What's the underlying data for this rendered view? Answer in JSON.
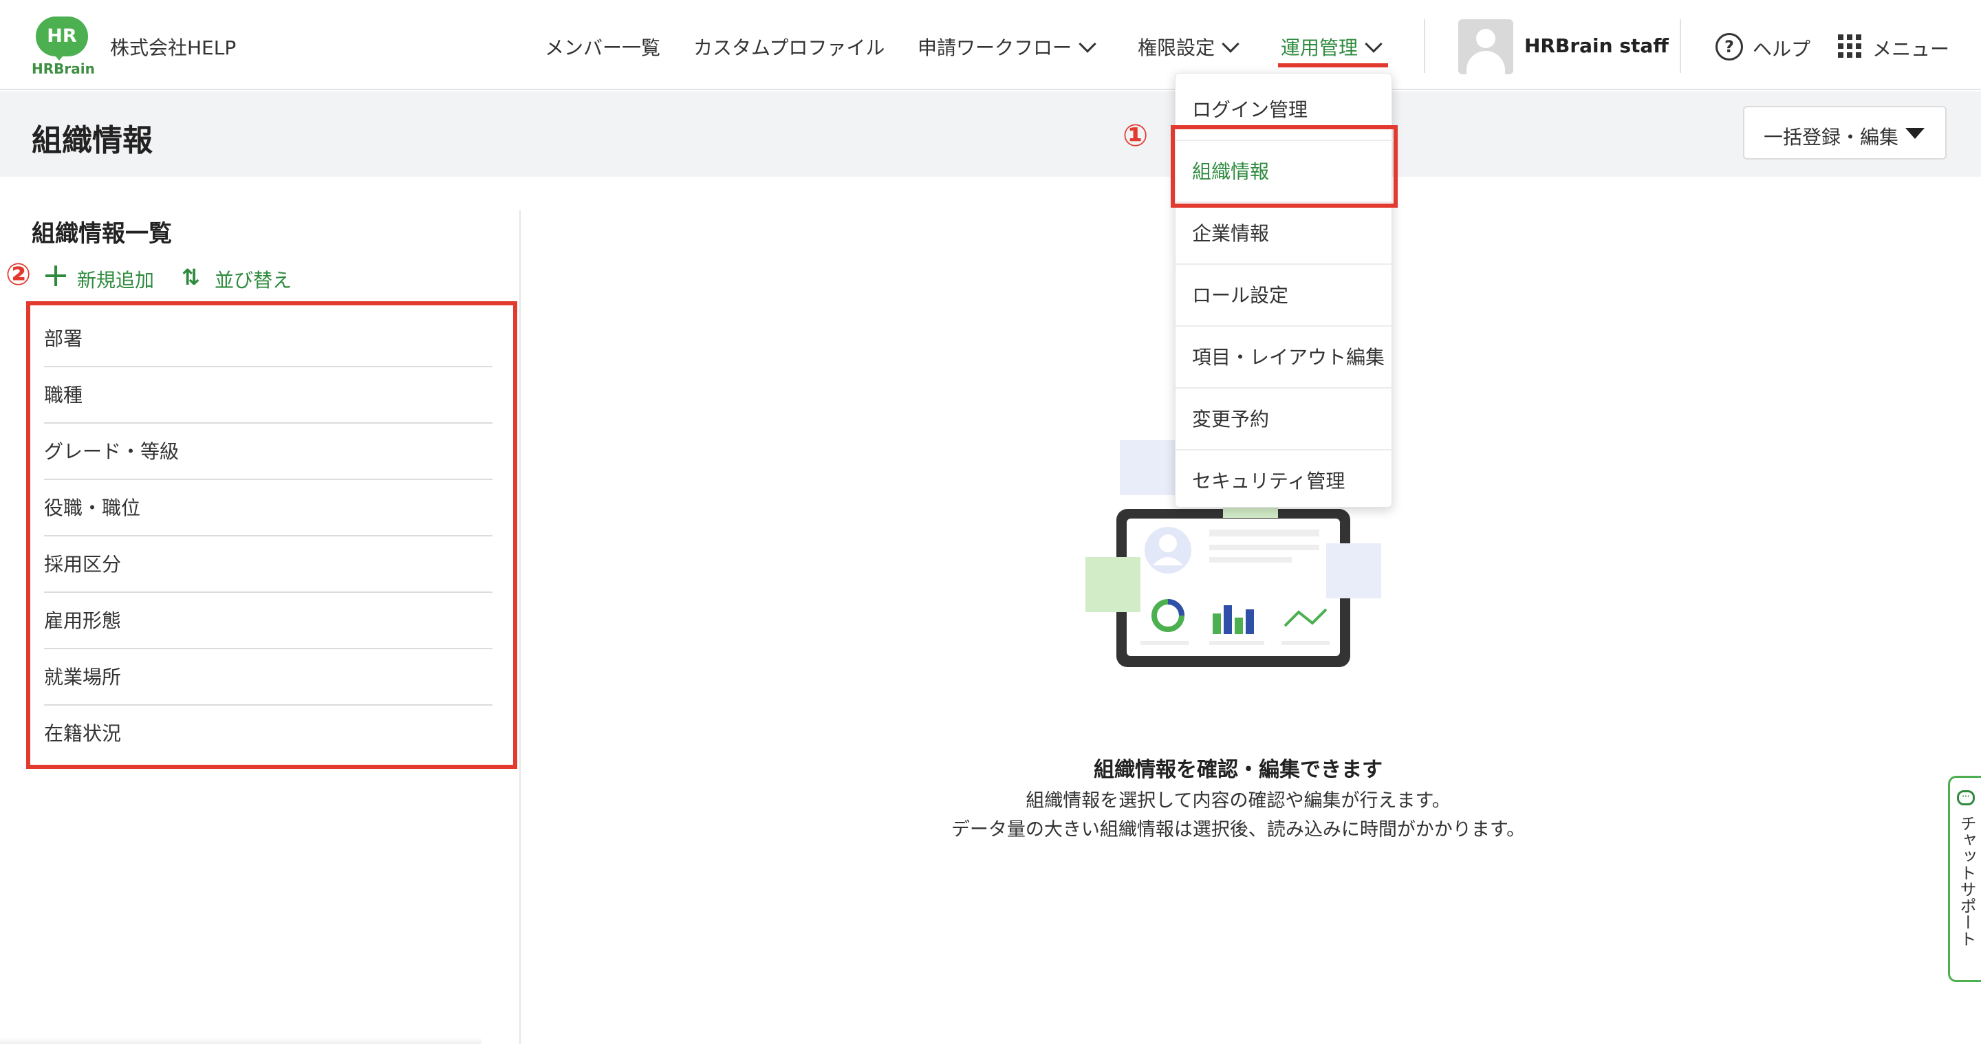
{
  "header": {
    "logo_text": "HR",
    "logo_sub": "HRBrain",
    "company_name": "株式会社HELP",
    "nav": [
      {
        "label": "メンバー一覧"
      },
      {
        "label": "カスタムプロファイル"
      },
      {
        "label": "申請ワークフロー"
      },
      {
        "label": "権限設定"
      },
      {
        "label": "運用管理"
      }
    ],
    "user_name": "HRBrain staff",
    "help_label": "ヘルプ",
    "menu_label": "メニュー"
  },
  "page": {
    "title": "組織情報",
    "bulk_button": "一括登録・編集"
  },
  "sidebar": {
    "heading": "組織情報一覧",
    "add_label": "新規追加",
    "sort_icon": "⇅",
    "sort_label": "並び替え",
    "items": [
      {
        "label": "部署"
      },
      {
        "label": "職種"
      },
      {
        "label": "グレード・等級"
      },
      {
        "label": "役職・職位"
      },
      {
        "label": "採用区分"
      },
      {
        "label": "雇用形態"
      },
      {
        "label": "就業場所"
      },
      {
        "label": "在籍状況"
      }
    ]
  },
  "dropdown": {
    "items": [
      {
        "label": "ログイン管理"
      },
      {
        "label": "組織情報"
      },
      {
        "label": "企業情報"
      },
      {
        "label": "ロール設定"
      },
      {
        "label": "項目・レイアウト編集"
      },
      {
        "label": "変更予約"
      },
      {
        "label": "セキュリティ管理"
      }
    ]
  },
  "annotations": {
    "one": "①",
    "two": "②"
  },
  "empty_state": {
    "title": "組織情報を確認・編集できます",
    "line1": "組織情報を選択して内容の確認や編集が行えます。",
    "line2": "データ量の大きい組織情報は選択後、読み込みに時間がかかります。"
  },
  "chat": {
    "label": "チャットサポート"
  },
  "colors": {
    "brand_green": "#4caf50",
    "link_green": "#2e8b3e",
    "annotation_red": "#e23a2f"
  }
}
